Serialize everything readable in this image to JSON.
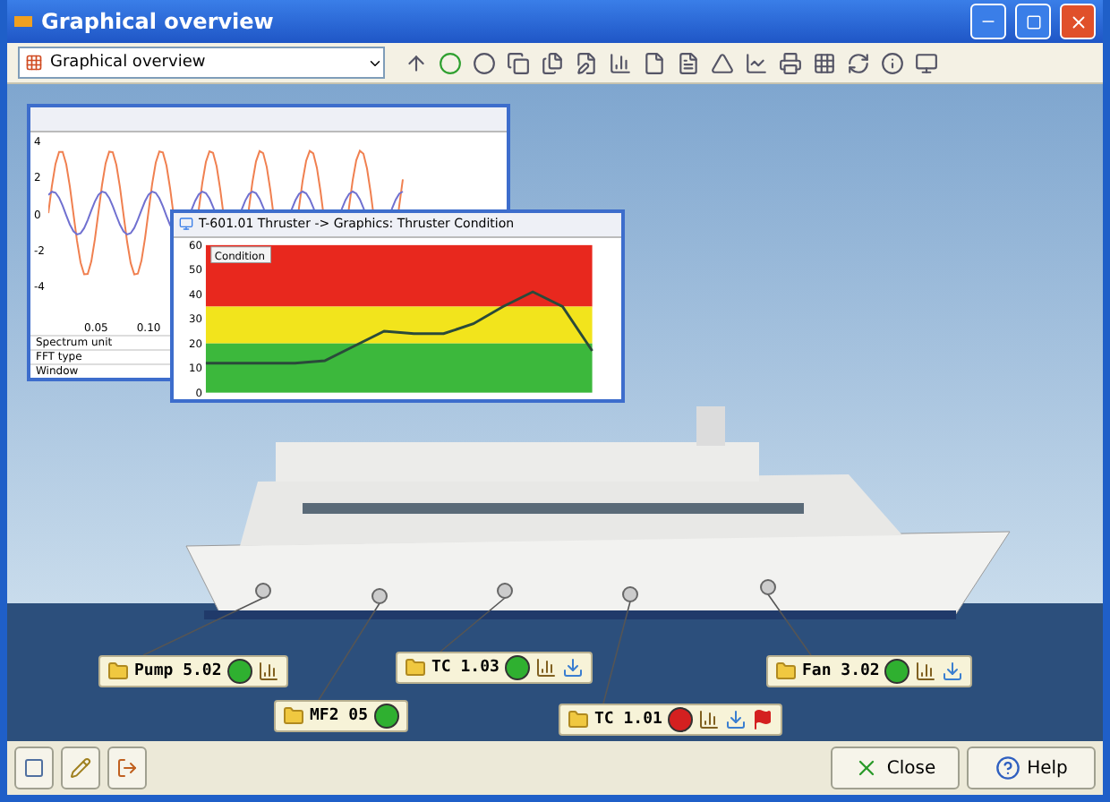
{
  "window": {
    "title": "Graphical overview"
  },
  "toolbar": {
    "view_select": "Graphical overview"
  },
  "spectrum_window": {
    "y_ticks": [
      "4",
      "2",
      "0",
      "-2",
      "-4"
    ],
    "x_ticks": [
      "0.05",
      "0.10"
    ],
    "settings": [
      {
        "label": "Spectrum unit"
      },
      {
        "label": "FFT type"
      },
      {
        "label": "Window"
      }
    ]
  },
  "condition_window": {
    "title": "T-601.01 Thruster -> Graphics: Thruster Condition",
    "chart_data": {
      "type": "line",
      "ylim": [
        0,
        60
      ],
      "yticks": [
        0,
        10,
        20,
        30,
        40,
        50,
        60
      ],
      "series": [
        {
          "name": "Condition",
          "color": "#2a4a3a",
          "values": [
            12,
            12,
            12,
            12,
            13,
            19,
            25,
            24,
            24,
            28,
            35,
            41,
            35,
            17
          ]
        }
      ]
    }
  },
  "tags": [
    {
      "label": "Pump 5.02",
      "color": "#2fb030",
      "trend": true,
      "download": false,
      "flag": false
    },
    {
      "label": "MF2 05",
      "color": "#2fb030",
      "trend": false,
      "download": false,
      "flag": false
    },
    {
      "label": "TC 1.03",
      "color": "#2fb030",
      "trend": true,
      "download": true,
      "flag": false
    },
    {
      "label": "TC 1.01",
      "color": "#d42020",
      "trend": true,
      "download": true,
      "flag": true
    },
    {
      "label": "Fan 3.02",
      "color": "#2fb030",
      "trend": true,
      "download": true,
      "flag": false
    }
  ],
  "buttons": [
    {
      "kind": "close",
      "label": "Close"
    },
    {
      "kind": "help",
      "label": "Help"
    }
  ]
}
